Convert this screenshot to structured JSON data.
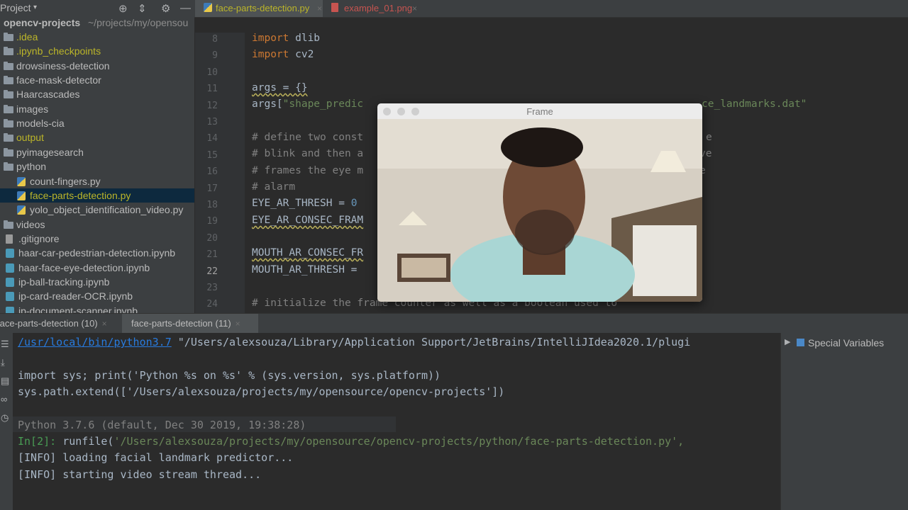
{
  "project_header": {
    "title": "Project",
    "dropdown": "▾",
    "icons": [
      "crosshair-icon",
      "collapse-icon",
      "gear-icon",
      "minimize-icon"
    ]
  },
  "tree": {
    "root_name": "opencv-projects",
    "root_path": "~/projects/my/opensou",
    "items": [
      {
        "label": ".idea",
        "type": "folder",
        "color": "#bbb529"
      },
      {
        "label": ".ipynb_checkpoints",
        "type": "folder",
        "color": "#bbb529"
      },
      {
        "label": "drowsiness-detection",
        "type": "folder",
        "color": "#bbbbbb"
      },
      {
        "label": "face-mask-detector",
        "type": "folder",
        "color": "#bbbbbb"
      },
      {
        "label": "Haarcascades",
        "type": "folder",
        "color": "#bbbbbb"
      },
      {
        "label": "images",
        "type": "folder",
        "color": "#bbbbbb"
      },
      {
        "label": "models-cia",
        "type": "folder",
        "color": "#bbbbbb"
      },
      {
        "label": "output",
        "type": "folder",
        "color": "#bbb529"
      },
      {
        "label": "pyimagesearch",
        "type": "folder",
        "color": "#bbbbbb"
      },
      {
        "label": "python",
        "type": "folder",
        "color": "#bbbbbb"
      },
      {
        "label": "count-fingers.py",
        "type": "py",
        "color": "#bbbbbb"
      },
      {
        "label": "face-parts-detection.py",
        "type": "py",
        "color": "#bbb529",
        "selected": true
      },
      {
        "label": "yolo_object_identification_video.py",
        "type": "py",
        "color": "#bbbbbb"
      },
      {
        "label": "videos",
        "type": "folder",
        "color": "#bbbbbb"
      },
      {
        "label": ".gitignore",
        "type": "txt",
        "color": "#bbbbbb"
      },
      {
        "label": "haar-car-pedestrian-detection.ipynb",
        "type": "nb",
        "color": "#bbbbbb"
      },
      {
        "label": "haar-face-eye-detection.ipynb",
        "type": "nb",
        "color": "#bbbbbb"
      },
      {
        "label": "ip-ball-tracking.ipynb",
        "type": "nb",
        "color": "#bbbbbb"
      },
      {
        "label": "ip-card-reader-OCR.ipynb",
        "type": "nb",
        "color": "#bbbbbb"
      },
      {
        "label": "ip-document-scanner.ipynb",
        "type": "nb",
        "color": "#bbbbbb"
      }
    ]
  },
  "editor_tabs": [
    {
      "label": "face-parts-detection.py",
      "close": "×",
      "color": "#bbb529"
    },
    {
      "label": "example_01.png",
      "close": "×",
      "color": "#c75450"
    }
  ],
  "line_numbers": [
    "8",
    "9",
    "10",
    "11",
    "12",
    "13",
    "14",
    "15",
    "16",
    "17",
    "18",
    "19",
    "20",
    "21",
    "22",
    "23",
    "24"
  ],
  "code": {
    "l8_kw": "import",
    "l8_rest": " dlib",
    "l9_kw": "import",
    "l9_rest": " cv2",
    "l11": "args = {}",
    "l12_a": "args[",
    "l12_b": "\"shape_predic",
    "l12_c": "ce_landmarks.dat\"",
    "l14_a": "# define two const",
    "l14_b": "e",
    "l15_a": "# blink and then a",
    "l15_b": "ve",
    "l16_a": "# frames the eye m",
    "l16_b": "e",
    "l17": "# alarm",
    "l18_a": "EYE_AR_THRESH = ",
    "l18_b": "0",
    "l19": "EYE_AR_CONSEC_FRAM",
    "l21": "MOUTH_AR_CONSEC_FR",
    "l22": "MOUTH_AR_THRESH = ",
    "l24_a": "# initialize the frame counter as well as a boolean used to"
  },
  "frame_window": {
    "title": "Frame"
  },
  "run_tabs": [
    {
      "label": "face-parts-detection (10)",
      "close": "×"
    },
    {
      "label": "face-parts-detection (11)",
      "close": "×"
    }
  ],
  "run_side_icons": [
    "rerun-icon",
    "scroll-end-icon",
    "print-icon",
    "glasses-icon",
    "history-icon"
  ],
  "console": {
    "l1_link": "/usr/local/bin/python3.7",
    "l1_rest": " \"/Users/alexsouza/Library/Application Support/JetBrains/IntelliJIdea2020.1/plugi",
    "l2": "import sys; print('Python %s on %s' % (sys.version, sys.platform))",
    "l3": "sys.path.extend(['/Users/alexsouza/projects/my/opensource/opencv-projects'])",
    "l4": "Python 3.7.6 (default, Dec 30 2019, 19:38:28)",
    "l5_prompt": "In[2]:",
    "l5_fn": " runfile(",
    "l5_str": "'/Users/alexsouza/projects/my/opensource/opencv-projects/python/face-parts-detection.py',",
    "l6": "[INFO] loading facial landmark predictor...",
    "l7": "[INFO] starting video stream thread..."
  },
  "variables_panel": {
    "label": "Special Variables",
    "arrow": "▶"
  }
}
